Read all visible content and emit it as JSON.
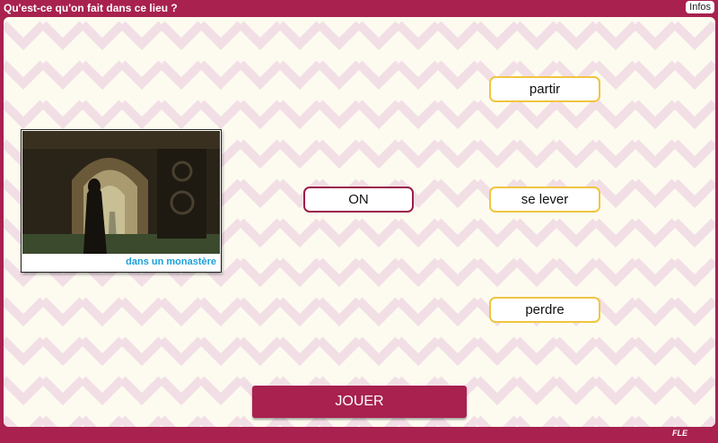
{
  "header": {
    "title": "Qu'est-ce qu'on fait dans ce lieu ?",
    "infos_label": "Infos"
  },
  "image_card": {
    "caption": "dans un monastère",
    "icon": "monastery-monk-photo"
  },
  "subject": {
    "label": "ON"
  },
  "choices": [
    {
      "label": "partir"
    },
    {
      "label": "se lever"
    },
    {
      "label": "perdre"
    }
  ],
  "play_button": {
    "label": "JOUER"
  },
  "footer": {
    "logo_text": "FLE"
  },
  "colors": {
    "frame": "#a8214f",
    "background": "#fdfbf0",
    "chevron": "#f2dfe6",
    "subject_border": "#9c1f48",
    "choice_border": "#f0c540",
    "caption": "#1d9fd8"
  }
}
